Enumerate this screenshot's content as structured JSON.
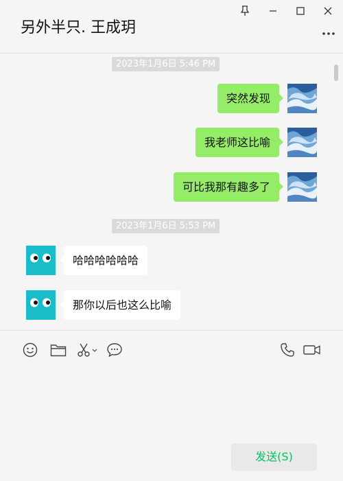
{
  "header": {
    "title": "另外半只. 王成玥"
  },
  "window_controls": [
    "pin-icon",
    "minimize-icon",
    "maximize-icon",
    "close-icon"
  ],
  "timestamps": [
    "2023年1月6日 5:46 PM",
    "2023年1月6日 5:53 PM"
  ],
  "messages": [
    {
      "sender": "me",
      "text": "突然发现"
    },
    {
      "sender": "me",
      "text": "我老师这比喻"
    },
    {
      "sender": "me",
      "text": "可比我那有趣多了"
    },
    {
      "sender": "them",
      "text": "哈哈哈哈哈哈"
    },
    {
      "sender": "them",
      "text": "那你以后也这么比喻"
    }
  ],
  "toolbar": {
    "left_icons": [
      "emoji-icon",
      "folder-icon",
      "scissors-icon",
      "chat-bubble-icon"
    ],
    "right_icons": [
      "phone-icon",
      "video-icon"
    ]
  },
  "send_label": "发送(S)",
  "colors": {
    "my_bubble": "#95ec69",
    "their_bubble": "#ffffff",
    "send_text": "#07c160",
    "their_avatar": "#1bbcc9"
  }
}
